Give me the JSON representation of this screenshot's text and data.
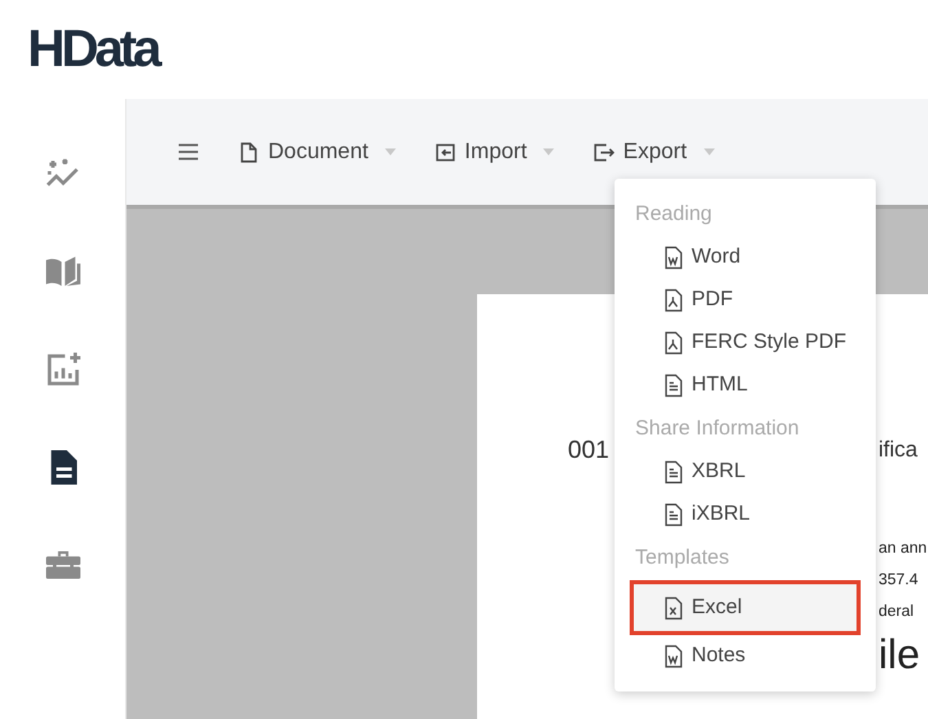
{
  "logo": "HData",
  "sidebar": {
    "items": [
      {
        "kind": "insights",
        "selected": false
      },
      {
        "kind": "book",
        "selected": false
      },
      {
        "kind": "chart",
        "selected": false
      },
      {
        "kind": "document",
        "selected": true
      },
      {
        "kind": "toolbox",
        "selected": false
      }
    ]
  },
  "toolbar": {
    "menus": [
      {
        "kind": "document",
        "label": "Document"
      },
      {
        "kind": "import",
        "label": "Import"
      },
      {
        "kind": "export",
        "label": "Export"
      }
    ]
  },
  "export_menu": {
    "groups": [
      {
        "heading": "Reading",
        "items": [
          {
            "kind": "word",
            "label": "Word",
            "highlighted": false
          },
          {
            "kind": "pdf",
            "label": "PDF",
            "highlighted": false
          },
          {
            "kind": "pdf",
            "label": "FERC Style PDF",
            "highlighted": false
          },
          {
            "kind": "text",
            "label": "HTML",
            "highlighted": false
          }
        ]
      },
      {
        "heading": "Share Information",
        "items": [
          {
            "kind": "text",
            "label": "XBRL",
            "highlighted": false
          },
          {
            "kind": "text",
            "label": "iXBRL",
            "highlighted": false
          }
        ]
      },
      {
        "heading": "Templates",
        "items": [
          {
            "kind": "excel",
            "label": "Excel",
            "highlighted": true
          },
          {
            "kind": "word",
            "label": "Notes",
            "highlighted": false
          }
        ]
      }
    ]
  },
  "document_page": {
    "number": "001",
    "title_fragment": "ifica",
    "lines": [
      "an ann",
      "357.4",
      "deral"
    ],
    "heading_fragment": "ile"
  }
}
